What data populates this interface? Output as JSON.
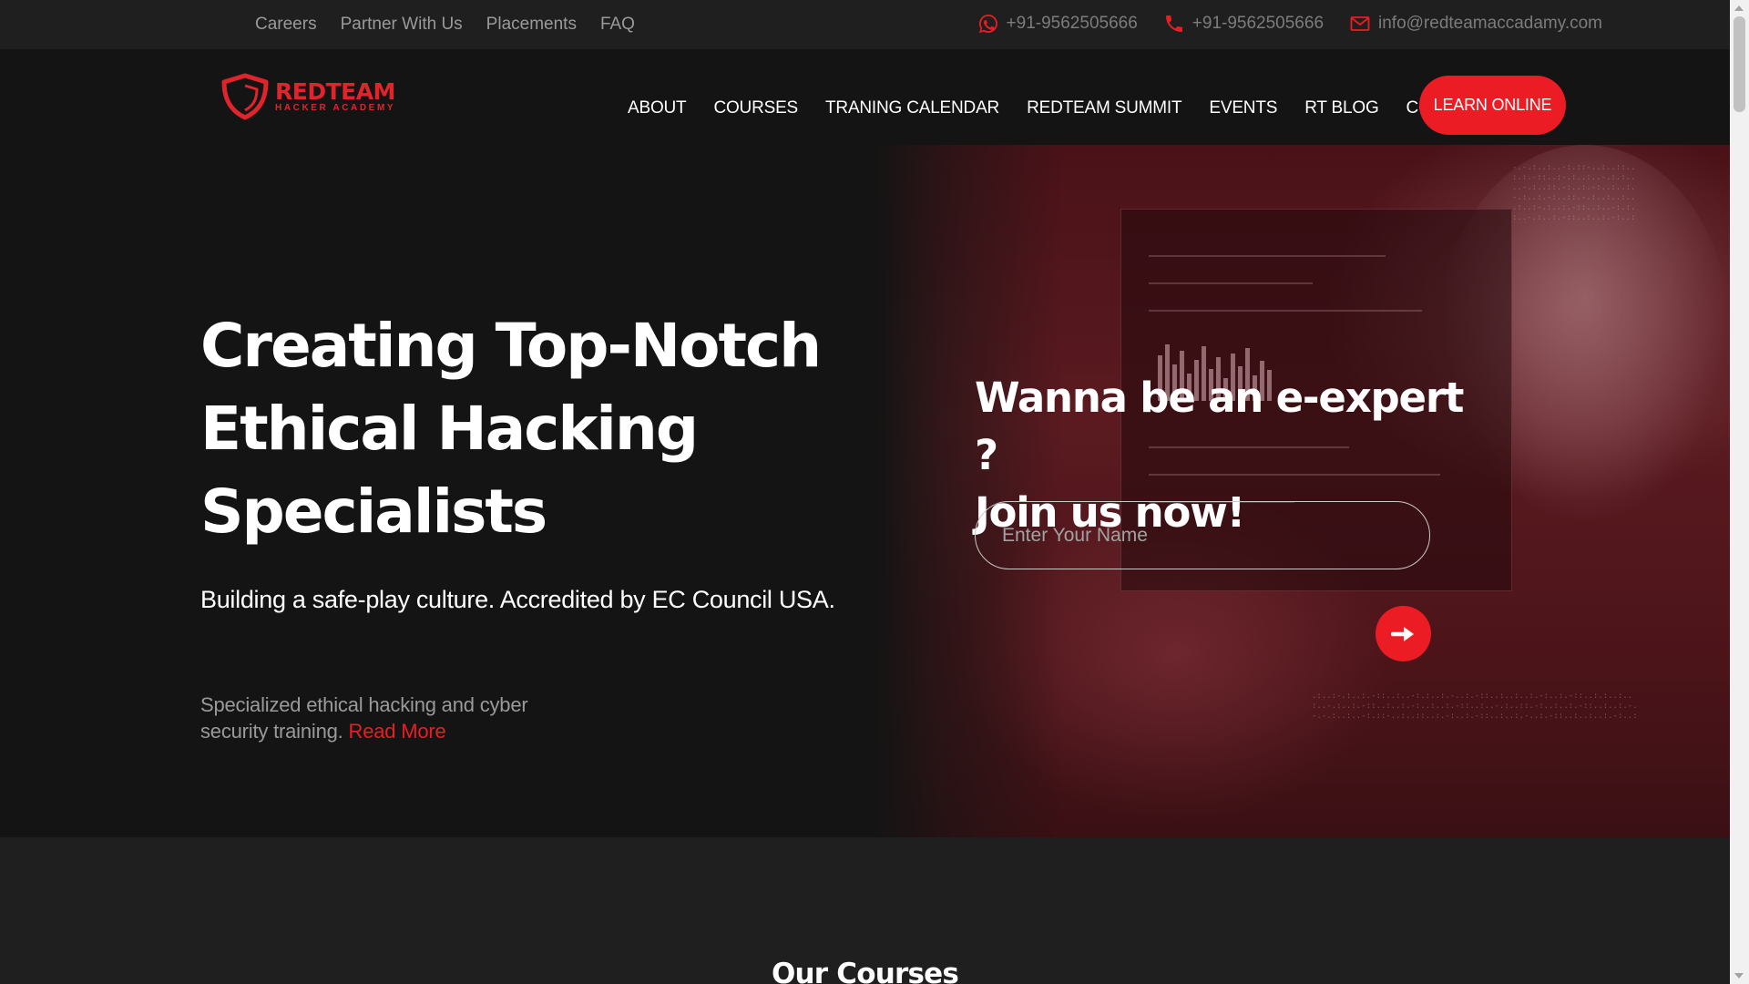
{
  "topbar": {
    "links": [
      "Careers",
      "Partner With Us",
      "Placements",
      "FAQ"
    ],
    "whatsapp": "+91-9562505666",
    "phone": "+91-9562505666",
    "email": "info@redteamaccadamy.com",
    "icons": {
      "whatsapp": "whatsapp-icon",
      "phone": "phone-icon",
      "email": "mail-icon"
    }
  },
  "logo": {
    "main": "REDTEAM",
    "sub": "HACKER ACADEMY"
  },
  "nav": {
    "items": [
      "ABOUT",
      "COURSES",
      "TRANING CALENDAR",
      "REDTEAM SUMMIT",
      "EVENTS",
      "RT BLOG",
      "CONTACT"
    ],
    "cta": "LEARN ONLINE"
  },
  "hero": {
    "title": "Creating Top-Notch Ethical Hacking Specialists",
    "subtitle": "Building a safe-play culture. Accredited by EC Council USA.",
    "description": "Specialized ethical hacking and cyber security training.",
    "read_more": "Read More"
  },
  "form": {
    "title_line1": "Wanna be an e-expert ?",
    "title_line2": "Join us now!",
    "name_placeholder": "Enter Your Name",
    "name_value": "",
    "submit_icon": "arrow-right-icon"
  },
  "courses": {
    "heading": "Our Courses"
  },
  "colors": {
    "accent": "#ec1c24",
    "background": "#141414",
    "topbar": "#1f1f1f",
    "muted_text": "#9a9a9a"
  }
}
